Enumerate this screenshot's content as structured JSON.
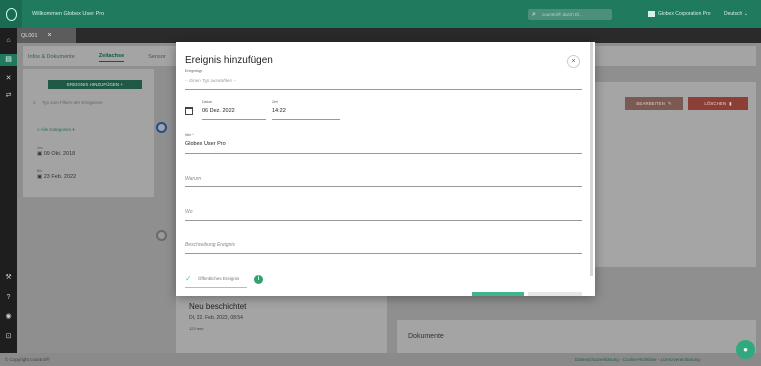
{
  "topbar": {
    "welcome": "Willkommen Globex User Pro",
    "search_placeholder": "countrol® durch El...",
    "company": "Globex Corporation Pro",
    "language": "Deutsch",
    "language_chevron": "chevron-down-icon"
  },
  "tabs": [
    {
      "label": "QL001"
    }
  ],
  "subtabs": [
    "Infos & Dokumente",
    "Zeitachse",
    "Sensor"
  ],
  "timeline_panel": {
    "add_button": "EREIGNIS HINZUFÜGEN",
    "search_placeholder": "Typ zum Filtern der Ereignisse",
    "filter_label": "Alle Kategorien",
    "from_label": "Von",
    "from_date": "09 Okt. 2018",
    "to_label": "Bis",
    "to_date": "23 Feb. 2022"
  },
  "detail": {
    "edit_button": "BEARBEITEN",
    "delete_button": "LÖSCHEN",
    "event_title": "Neu beschichtet",
    "event_date": "DI, 22. Feb. 2022, 08:54",
    "event_meta": "123 mm"
  },
  "documents_heading": "Dokumente",
  "footer": {
    "copyright": "© Copyright countrol®",
    "links": "Datenschutzerklärung - Cookie-Richtlinie - Lizenzvereinbarung"
  },
  "modal": {
    "title": "Ereignis hinzufügen",
    "type_label": "Ereignistyp",
    "type_placeholder": "-- Einen Typ auswählen --",
    "date_label": "Datum",
    "date_value": "06 Dez. 2022",
    "time_label": "Zeit",
    "time_value": "14:22",
    "by_label": "Wer *",
    "by_value": "Globex User Pro",
    "why_placeholder": "Warum",
    "where_placeholder": "Wo",
    "description_placeholder": "Beschreibung Ereignis",
    "public_label": "Öffentliches Ereignis"
  },
  "colors": {
    "brand_green": "#1f7a5e",
    "accent_green": "#3fb48d",
    "danger_red": "#c0392b"
  }
}
